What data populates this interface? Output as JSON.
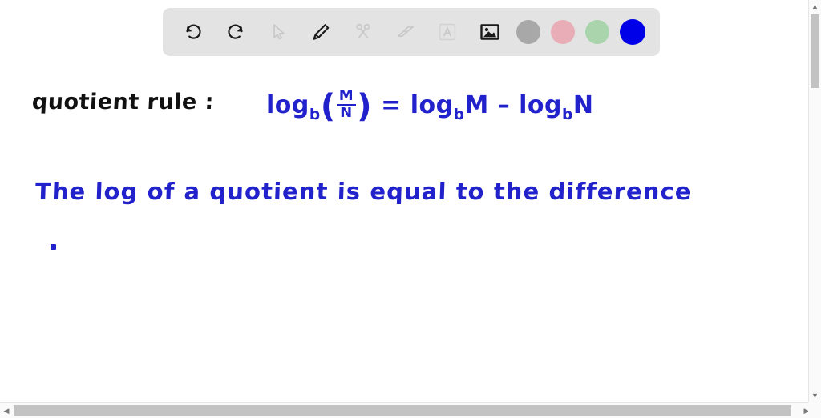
{
  "app": {
    "type": "whiteboard-canvas",
    "background_color": "#ffffff"
  },
  "toolbar": {
    "background_color": "#e3e3e3",
    "tools": [
      {
        "name": "undo-icon",
        "label": "Undo",
        "state": "enabled",
        "color": "#1a1a1a"
      },
      {
        "name": "redo-icon",
        "label": "Redo",
        "state": "enabled",
        "color": "#1a1a1a"
      },
      {
        "name": "cursor-icon",
        "label": "Select",
        "state": "disabled",
        "color": "#c9c9c9"
      },
      {
        "name": "pencil-icon",
        "label": "Pen",
        "state": "active",
        "color": "#1a1a1a"
      },
      {
        "name": "scissors-icon",
        "label": "Cut",
        "state": "disabled",
        "color": "#c9c9c9"
      },
      {
        "name": "eraser-icon",
        "label": "Eraser",
        "state": "disabled",
        "color": "#c9c9c9"
      },
      {
        "name": "text-icon",
        "label": "Text",
        "state": "disabled",
        "color": "#c9c9c9"
      },
      {
        "name": "image-icon",
        "label": "Image",
        "state": "enabled",
        "color": "#1a1a1a"
      }
    ],
    "swatches": [
      {
        "name": "color-swatch-grey",
        "label": "Grey",
        "color": "#a8a8a8",
        "selected": false
      },
      {
        "name": "color-swatch-pink",
        "label": "Pink",
        "color": "#e8adb6",
        "selected": false
      },
      {
        "name": "color-swatch-green",
        "label": "Green",
        "color": "#a9d4ac",
        "selected": false
      },
      {
        "name": "color-swatch-blue",
        "label": "Blue",
        "color": "#0000e8",
        "selected": true
      }
    ]
  },
  "canvas": {
    "annotations": {
      "heading_label": "quotient rule :",
      "heading_color": "#111111",
      "formula": {
        "color": "#2222cc",
        "log_left": "log",
        "base_left": "b",
        "open_paren": "(",
        "numerator": "M",
        "denominator": "N",
        "close_paren": ")",
        "equals": "=",
        "log_mid": "log",
        "base_mid": "b",
        "operand_m": "M",
        "minus": "–",
        "log_right": "log",
        "base_right": "b",
        "operand_n": "N",
        "plain_text": "log_b(M/N) = log_b M – log_b N"
      },
      "sentence": "The log of a quotient is equal to the difference",
      "sentence_color": "#2222cc",
      "stray_dot": "."
    }
  },
  "scrollbars": {
    "vertical": {
      "up_arrow": "▲",
      "down_arrow": "▼",
      "thumb_color": "#c2c2c2"
    },
    "horizontal": {
      "left_arrow": "◀",
      "right_arrow": "▶",
      "thumb_color": "#c2c2c2"
    }
  }
}
